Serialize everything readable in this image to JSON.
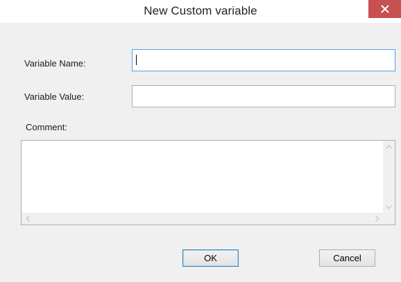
{
  "dialog": {
    "title": "New Custom variable",
    "close_icon": "close-icon",
    "close_color": "#c75050"
  },
  "form": {
    "variable_name_label": "Variable Name:",
    "variable_name_value": "",
    "variable_value_label": "Variable Value:",
    "variable_value_value": "",
    "comment_label": "Comment:",
    "comment_value": ""
  },
  "buttons": {
    "ok_label": "OK",
    "cancel_label": "Cancel"
  },
  "colors": {
    "focus_border": "#569de5",
    "default_button_border": "#3c7fb1"
  }
}
